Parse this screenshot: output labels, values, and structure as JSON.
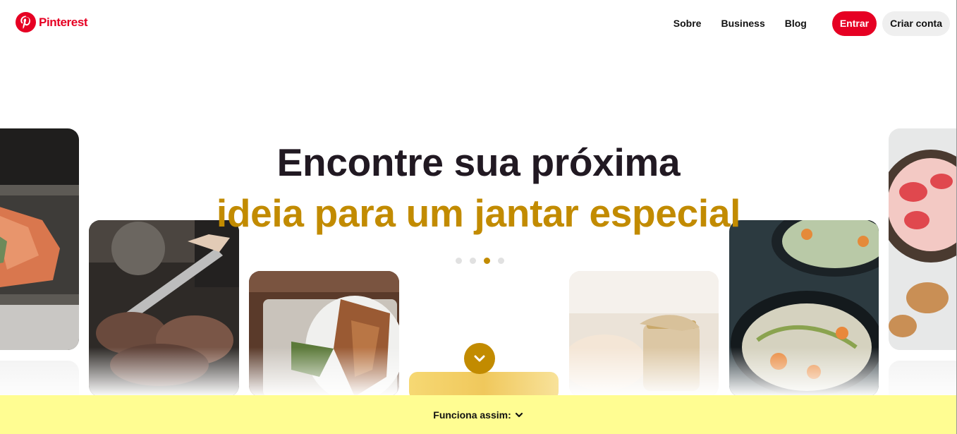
{
  "header": {
    "brand": "Pinterest",
    "nav": [
      {
        "label": "Sobre"
      },
      {
        "label": "Business"
      },
      {
        "label": "Blog"
      }
    ],
    "login_label": "Entrar",
    "signup_label": "Criar conta"
  },
  "hero": {
    "title": "Encontre sua próxima",
    "subtitle": "ideia para um jantar especial",
    "dots_total": 4,
    "active_dot_index": 3
  },
  "footer": {
    "label": "Funciona assim:"
  },
  "colors": {
    "brand_red": "#e60023",
    "accent_gold": "#c28b00",
    "banner_yellow": "#fffd92"
  },
  "icons": [
    "pinterest-logo-icon",
    "chevron-down-icon"
  ]
}
